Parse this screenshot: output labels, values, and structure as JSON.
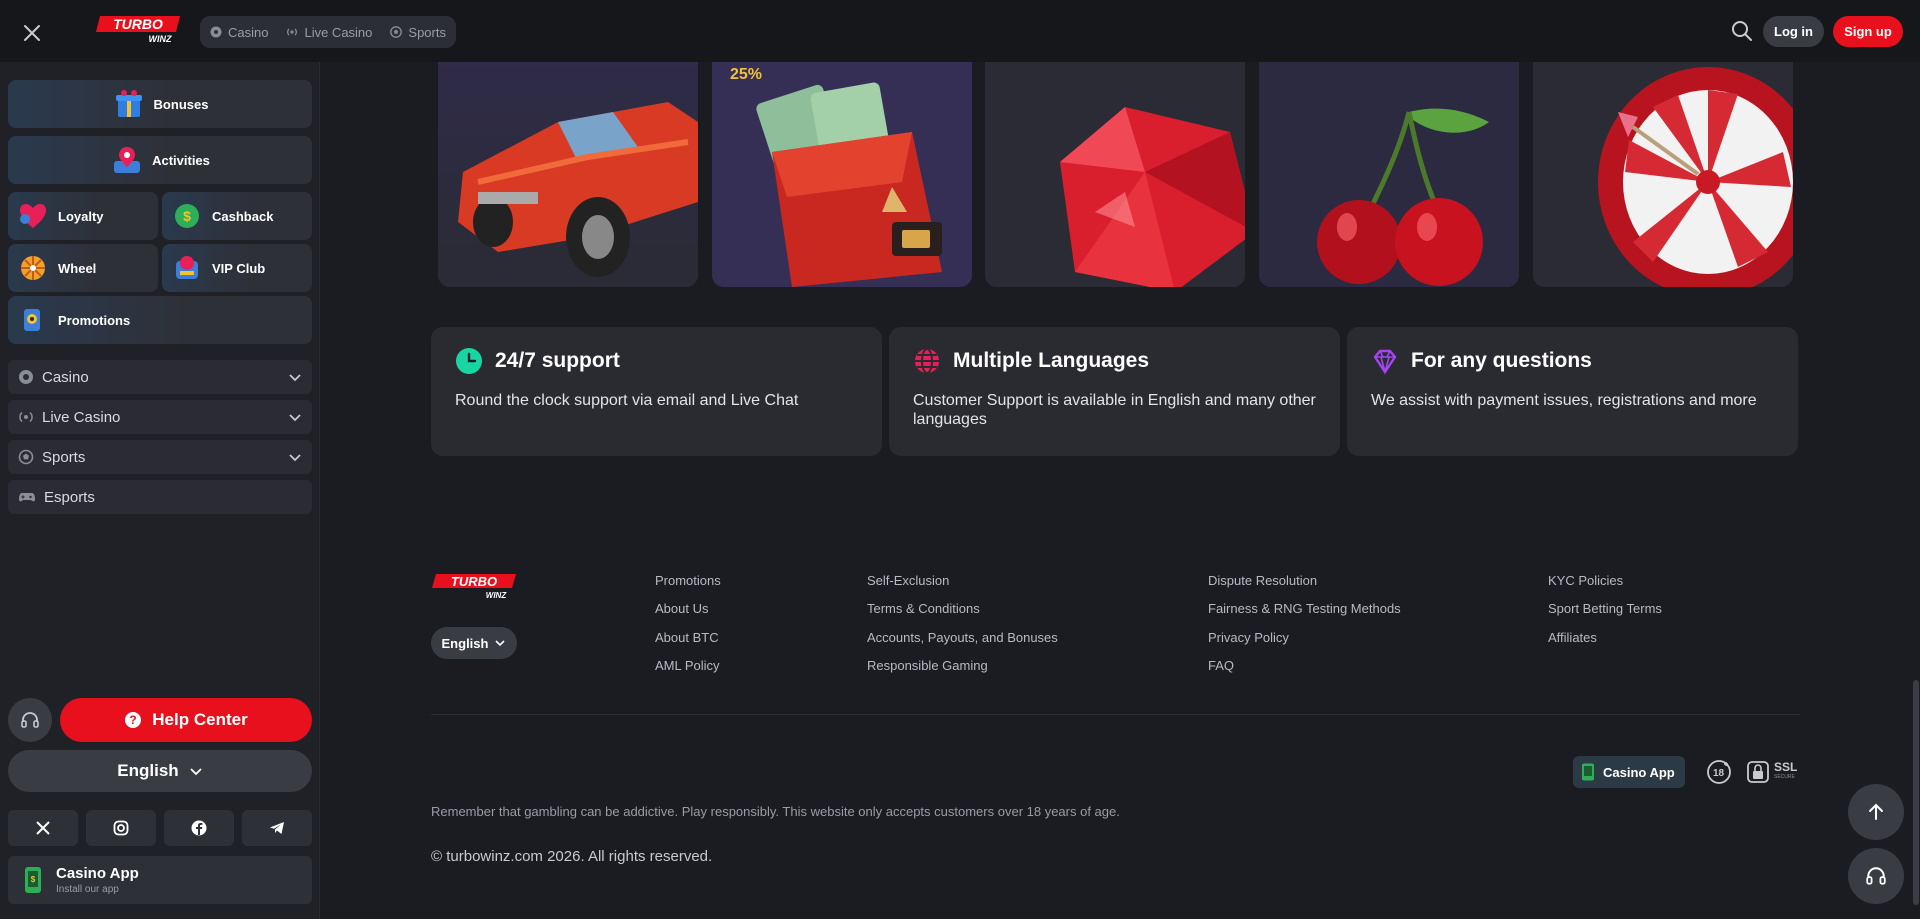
{
  "topbar": {
    "logo_text_top": "TURBO",
    "logo_text_bottom": "WINZ",
    "nav": [
      {
        "label": "Casino",
        "icon": "casino-chip-icon"
      },
      {
        "label": "Live Casino",
        "icon": "live-broadcast-icon"
      },
      {
        "label": "Sports",
        "icon": "soccer-ball-icon"
      }
    ],
    "login_label": "Log in",
    "signup_label": "Sign up"
  },
  "sidebar": {
    "bonuses_label": "Bonuses",
    "activities_label": "Activities",
    "loyalty_label": "Loyalty",
    "cashback_label": "Cashback",
    "wheel_label": "Wheel",
    "vip_label": "VIP Club",
    "promotions_label": "Promotions",
    "sections": [
      {
        "label": "Casino",
        "icon": "casino-chip-icon",
        "expandable": true
      },
      {
        "label": "Live Casino",
        "icon": "live-broadcast-icon",
        "expandable": true
      },
      {
        "label": "Sports",
        "icon": "soccer-ball-icon",
        "expandable": true
      },
      {
        "label": "Esports",
        "icon": "gamepad-icon",
        "expandable": false
      }
    ],
    "help_label": "Help Center",
    "language_label": "English",
    "socials": [
      "x-icon",
      "instagram-icon",
      "facebook-icon",
      "telegram-icon"
    ],
    "app_title": "Casino App",
    "app_subtitle": "Install our app"
  },
  "promo_cards": {
    "percent_label": "25%",
    "items": [
      "car-illustration",
      "wallet-illustration",
      "ruby-illustration",
      "cherry-illustration",
      "dartboard-illustration"
    ]
  },
  "features": [
    {
      "title": "24/7 support",
      "desc": "Round the clock support via email and Live Chat",
      "icon": "clock-icon",
      "color": "#18d6a3"
    },
    {
      "title": "Multiple Languages",
      "desc": "Customer Support is available in English and many other languages",
      "icon": "globe-icon",
      "color": "#e8205a"
    },
    {
      "title": "For any questions",
      "desc": "We assist with payment issues, registrations and more",
      "icon": "diamond-icon",
      "color": "#a545f0"
    }
  ],
  "footer": {
    "language_label": "English",
    "col1": [
      "Promotions",
      "About Us",
      "About BTC",
      "AML Policy"
    ],
    "col2": [
      "Self-Exclusion",
      "Terms & Conditions",
      "Accounts, Payouts, and Bonuses",
      "Responsible Gaming"
    ],
    "col3": [
      "Dispute Resolution",
      "Fairness & RNG Testing Methods",
      "Privacy Policy",
      "FAQ"
    ],
    "col4": [
      "KYC Policies",
      "Sport Betting Terms",
      "Affiliates"
    ],
    "casino_app_label": "Casino App",
    "age_badge": "18",
    "ssl_label": "SSL",
    "ssl_sub": "SECURE",
    "warning": "Remember that gambling can be addictive. Play responsibly. This website only accepts customers over 18 years of age.",
    "copyright": "© turbowinz.com 2026. All rights reserved."
  },
  "colors": {
    "accent_red": "#e8101c",
    "bg": "#1b1c22",
    "card": "#2a2b31"
  }
}
